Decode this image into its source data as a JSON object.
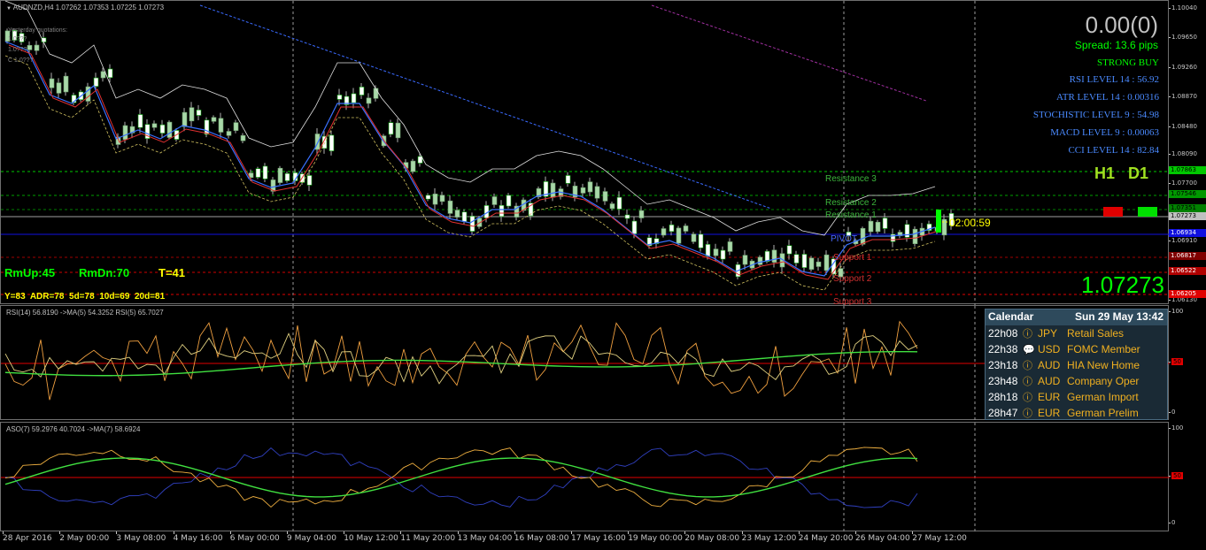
{
  "main": {
    "symbol_title": "AUDNZD,H4  1.07262 1.07353 1.07225 1.07273",
    "overlay_label_1": "Yesterday quotations:",
    "overlay_label_2": "1.0???",
    "overlay_label_3": "1.0???",
    "overlay_label_4": "C 1.0???",
    "profit": "0.00(0)",
    "spread": "Spread: 13.6 pips",
    "signal": "STRONG BUY",
    "rsi_level": "RSI LEVEL 14 : 56.92",
    "atr_level": "ATR LEVEL 14 : 0.00316",
    "stoch_level": "STOCHISTIC LEVEL 9 : 54.98",
    "macd_level": "MACD LEVEL 9 : 0.00063",
    "cci_level": "CCI LEVEL 14 : 82.84",
    "timeframes_label": "H1   D1",
    "big_price": "1.07273",
    "countdown": "02:00:59",
    "range_row_1a": "RmUp:45",
    "range_row_1b": "RmDn:70",
    "range_row_1c": "T=41",
    "range_row_2": "Y=83  ADR=78  5d=78  10d=69  20d=81",
    "resistance_3": "Resistance 3",
    "resistance_2": "Resistance 2",
    "resistance_1": "Resistance 1",
    "pivot": "PIVOT",
    "support_1": "Support 1",
    "support_2": "Support 2",
    "support_3": "Support 3",
    "colors": {
      "bull": "#ffffff",
      "bear": "#a8d8a8",
      "green_text": "#00ff00",
      "yellow_text": "#ffff00",
      "blue_text": "#4a8aff",
      "gray_text": "#c0c0c0"
    }
  },
  "price_axis": [
    "1.10040",
    "1.09650",
    "1.09260",
    "1.08870",
    "1.08480",
    "1.08090",
    "1.07700",
    "1.07351",
    "1.06910",
    "1.06520",
    "1.06130"
  ],
  "price_tags": {
    "r3": "1.07863",
    "r2": "1.07546",
    "r1": "1.07351",
    "current": "1.07273",
    "pivot": "1.06934",
    "s1": "1.06817",
    "s2": "1.06522",
    "s3": "1.06205"
  },
  "rsi": {
    "title": "RSI(14) 56.8190  ->MA(5) 54.3252  RSI(5) 65.7027",
    "axis": [
      "100",
      "50",
      "0"
    ]
  },
  "aso": {
    "title": "ASO(7) 59.2976 40.7024  ->MA(7) 58.6924",
    "axis": [
      "100",
      "50",
      "0"
    ]
  },
  "calendar": {
    "title": "Calendar",
    "date": "Sun 29 May 13:42",
    "events": [
      {
        "time": "22h08",
        "icon": "info-icon",
        "glyph": "ⓘ",
        "currency": "JPY",
        "event": "Retail Sales"
      },
      {
        "time": "22h38",
        "icon": "speech-icon",
        "glyph": "💬",
        "currency": "USD",
        "event": "FOMC Member"
      },
      {
        "time": "23h18",
        "icon": "info-icon",
        "glyph": "ⓘ",
        "currency": "AUD",
        "event": "HIA New Home"
      },
      {
        "time": "23h48",
        "icon": "info-icon",
        "glyph": "ⓘ",
        "currency": "AUD",
        "event": "Company Oper"
      },
      {
        "time": "28h18",
        "icon": "info-icon",
        "glyph": "ⓘ",
        "currency": "EUR",
        "event": "German Import"
      },
      {
        "time": "28h47",
        "icon": "info-icon",
        "glyph": "ⓘ",
        "currency": "EUR",
        "event": "German Prelim"
      }
    ]
  },
  "time_axis": [
    "28 Apr 2016",
    "2 May 00:00",
    "3 May 08:00",
    "4 May 16:00",
    "6 May 00:00",
    "9 May 04:00",
    "10 May 12:00",
    "11 May 20:00",
    "13 May 04:00",
    "16 May 08:00",
    "17 May 16:00",
    "19 May 00:00",
    "20 May 08:00",
    "23 May 12:00",
    "24 May 20:00",
    "26 May 04:00",
    "27 May 12:00"
  ]
}
